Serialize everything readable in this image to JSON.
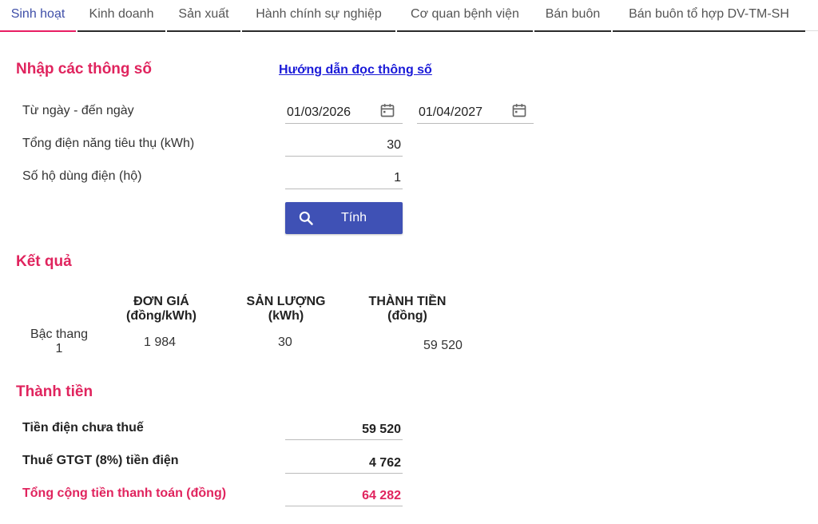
{
  "tabs": [
    {
      "label": "Sinh hoạt",
      "active": true
    },
    {
      "label": "Kinh doanh"
    },
    {
      "label": "Sản xuất"
    },
    {
      "label": "Hành chính sự nghiệp"
    },
    {
      "label": "Cơ quan bệnh viện"
    },
    {
      "label": "Bán buôn"
    },
    {
      "label": "Bán buôn tổ hợp DV-TM-SH"
    }
  ],
  "input": {
    "title": "Nhập các thông số",
    "guide_link": "Hướng dẫn đọc thông số",
    "date_label": "Từ ngày - đến ngày",
    "date_from": "01/03/2026",
    "date_to": "01/04/2027",
    "kwh_label": "Tổng điện năng tiêu thụ (kWh)",
    "kwh_value": "30",
    "households_label": "Số hộ dùng điện (hộ)",
    "households_value": "1",
    "calc_button": "Tính"
  },
  "result": {
    "title": "Kết quả",
    "col_price": "ĐƠN GIÁ",
    "col_price_unit": "(đồng/kWh)",
    "col_qty": "SẢN LƯỢNG",
    "col_qty_unit": "(kWh)",
    "col_amount": "THÀNH TIỀN",
    "col_amount_unit": "(đồng)",
    "row_label_1": "Bậc thang",
    "row_label_2": "1",
    "price": "1 984",
    "qty": "30",
    "amount": "59 520"
  },
  "total": {
    "title": "Thành tiền",
    "pre_tax_label": "Tiền điện chưa thuế",
    "pre_tax_value": "59 520",
    "vat_label": "Thuế GTGT (8%) tiền điện",
    "vat_value": "4 762",
    "grand_label": "Tổng cộng tiền thanh toán (đồng)",
    "grand_value": "64 282"
  },
  "colors": {
    "accent": "#e0245e",
    "primary": "#3f51b5",
    "link": "#1a1ad8"
  }
}
